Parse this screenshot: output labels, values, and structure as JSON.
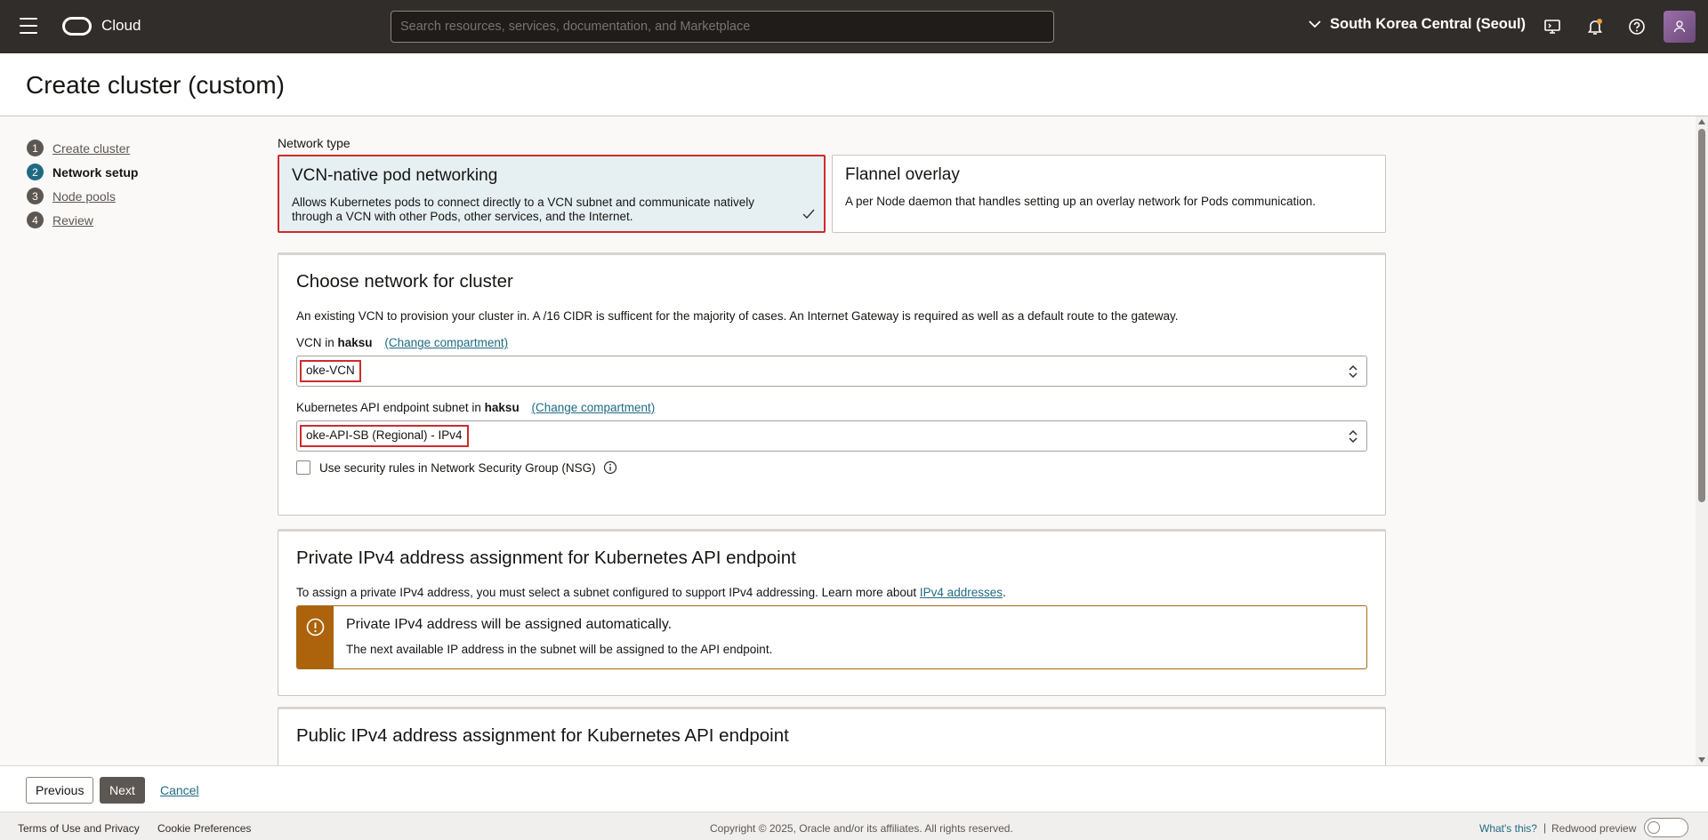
{
  "topbar": {
    "brand": "Cloud",
    "search_placeholder": "Search resources, services, documentation, and Marketplace",
    "region": "South Korea Central (Seoul)"
  },
  "page": {
    "title": "Create cluster (custom)"
  },
  "steps": [
    {
      "num": "1",
      "label": "Create cluster"
    },
    {
      "num": "2",
      "label": "Network setup"
    },
    {
      "num": "3",
      "label": "Node pools"
    },
    {
      "num": "4",
      "label": "Review"
    }
  ],
  "network_type": {
    "label": "Network type",
    "options": [
      {
        "title": "VCN-native pod networking",
        "desc": "Allows Kubernetes pods to connect directly to a VCN subnet and communicate natively through a VCN with other Pods, other services, and the Internet."
      },
      {
        "title": "Flannel overlay",
        "desc": "A per Node daemon that handles setting up an overlay network for Pods communication."
      }
    ]
  },
  "choose_network": {
    "title": "Choose network for cluster",
    "desc": "An existing VCN to provision your cluster in. A /16 CIDR is sufficent for the majority of cases. An Internet Gateway is required as well as a default route to the gateway.",
    "vcn_label": "VCN in",
    "compartment": "haksu",
    "change_compartment": "(Change compartment)",
    "vcn_value": "oke-VCN",
    "subnet_label": "Kubernetes API endpoint subnet in",
    "subnet_value": "oke-API-SB (Regional) - IPv4",
    "nsg_label": "Use security rules in Network Security Group (NSG)"
  },
  "private_ipv4": {
    "title": "Private IPv4 address assignment for Kubernetes API endpoint",
    "desc_prefix": "To assign a private IPv4 address, you must select a subnet configured to support IPv4 addressing. Learn more about",
    "desc_link": "IPv4 addresses",
    "desc_suffix": ".",
    "notice_title": "Private IPv4 address will be assigned automatically.",
    "notice_desc": "The next available IP address in the subnet will be assigned to the API endpoint."
  },
  "public_ipv4": {
    "title": "Public IPv4 address assignment for Kubernetes API endpoint"
  },
  "nav": {
    "previous": "Previous",
    "next": "Next",
    "cancel": "Cancel"
  },
  "footer": {
    "terms": "Terms of Use and Privacy",
    "cookies": "Cookie Preferences",
    "copyright": "Copyright © 2025, Oracle and/or its affiliates. All rights reserved.",
    "whats_this": "What's this?",
    "separator": "|",
    "redwood": "Redwood preview"
  }
}
